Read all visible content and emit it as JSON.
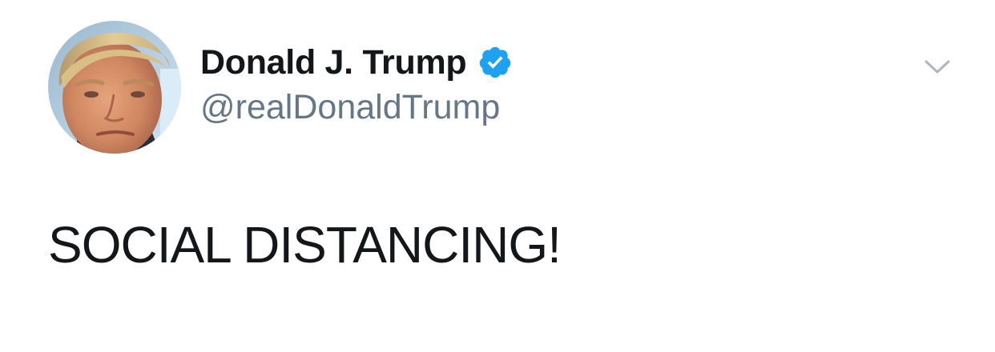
{
  "author": {
    "display_name": "Donald J. Trump",
    "handle": "@realDonaldTrump",
    "verified": true,
    "avatar_icon": "profile-photo",
    "verified_icon": "verified-badge-icon"
  },
  "tweet": {
    "text": "SOCIAL DISTANCING!"
  },
  "menu": {
    "icon": "chevron-down-icon"
  },
  "colors": {
    "verified_blue": "#1da1f2",
    "handle_gray": "#657786",
    "text_dark": "#14171a",
    "chevron_gray": "#aab8c2"
  }
}
